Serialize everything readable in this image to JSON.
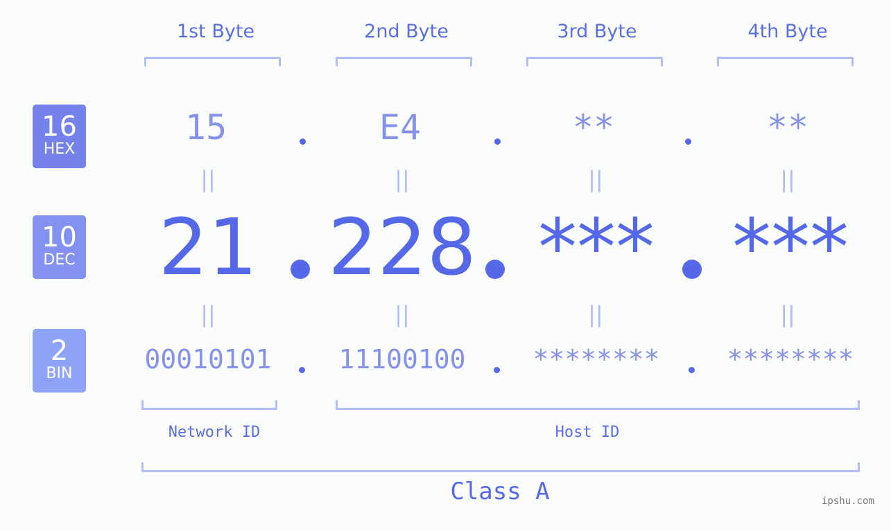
{
  "bytes": [
    {
      "header": "1st Byte",
      "hex": "15",
      "dec": "21",
      "bin": "00010101"
    },
    {
      "header": "2nd Byte",
      "hex": "E4",
      "dec": "228",
      "bin": "11100100"
    },
    {
      "header": "3rd Byte",
      "hex": "**",
      "dec": "***",
      "bin": "********"
    },
    {
      "header": "4th Byte",
      "hex": "**",
      "dec": "***",
      "bin": "********"
    }
  ],
  "bases": {
    "hex": {
      "num": "16",
      "label": "HEX",
      "color": "#7582eb"
    },
    "dec": {
      "num": "10",
      "label": "DEC",
      "color": "#8391f0"
    },
    "bin": {
      "num": "2",
      "label": "BIN",
      "color": "#8fa4f8"
    }
  },
  "equals_symbol": "||",
  "segments": {
    "network": "Network ID",
    "host": "Host ID"
  },
  "class_label": "Class A",
  "watermark": "ipshu.com",
  "colors": {
    "accent": "#5468e8",
    "light_accent": "#8592ea",
    "bracket": "#b3bdf5",
    "background": "#fbfdfc"
  }
}
